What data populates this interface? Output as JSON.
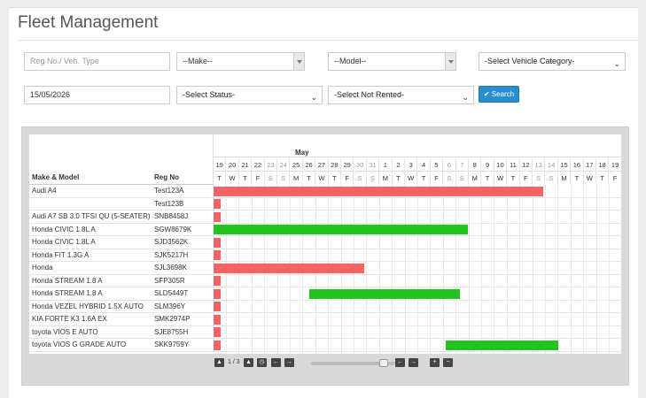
{
  "page": {
    "title": "Fleet Management"
  },
  "filters": {
    "reg_placeholder": "Reg No./ Veh. Type",
    "make": "--Make--",
    "model": "--Model--",
    "vehicle_category": "-Select Vehicle Category-",
    "date": "15/05/2026",
    "status": "-Select Status-",
    "not_rented": "-Select Not Rented-",
    "search_label": "Search"
  },
  "gantt": {
    "col_make_model": "Make & Model",
    "col_reg": "Reg No",
    "month": "May",
    "days": [
      "19",
      "20",
      "21",
      "22",
      "23",
      "24",
      "25",
      "26",
      "27",
      "28",
      "29",
      "30",
      "31",
      "1",
      "2",
      "3",
      "4",
      "5",
      "6",
      "7",
      "8",
      "9",
      "10",
      "11",
      "12",
      "13",
      "14",
      "15",
      "16",
      "17",
      "18",
      "19"
    ],
    "dows": [
      "T",
      "W",
      "T",
      "F",
      "S",
      "S",
      "M",
      "T",
      "W",
      "T",
      "F",
      "S",
      "S",
      "M",
      "T",
      "W",
      "T",
      "F",
      "S",
      "S",
      "M",
      "T",
      "W",
      "T",
      "F",
      "S",
      "S",
      "M",
      "T",
      "W",
      "T",
      "F"
    ],
    "weekend_index": [
      4,
      5,
      11,
      12,
      18,
      19,
      25,
      26
    ],
    "rows": [
      {
        "make_model": "Audi A4",
        "reg": "Test123A"
      },
      {
        "make_model": "",
        "reg": "Test123B"
      },
      {
        "make_model": "Audi A7 SB 3.0 TFSI QU (5-SEATER)",
        "reg": "SNB8458J"
      },
      {
        "make_model": "Honda CIVIC 1.8L A",
        "reg": "SGW8679K"
      },
      {
        "make_model": "Honda CIVIC 1.8L A",
        "reg": "SJD3562K"
      },
      {
        "make_model": "Honda FIT 1.3G A",
        "reg": "SJK5217H"
      },
      {
        "make_model": "Honda",
        "reg": "SJL3698K"
      },
      {
        "make_model": "Honda STREAM 1.8 A",
        "reg": "SFP305R"
      },
      {
        "make_model": "Honda STREAM 1.8 A",
        "reg": "SLD5449T"
      },
      {
        "make_model": "Honda VEZEL HYBRID 1.5X AUTO",
        "reg": "SLM396Y"
      },
      {
        "make_model": "KIA FORTE K3 1.6A EX",
        "reg": "SMK2974P"
      },
      {
        "make_model": "toyota VIOS E AUTO",
        "reg": "SJE8755H"
      },
      {
        "make_model": "toyota VIOS G GRADE AUTO",
        "reg": "SKK9759Y"
      }
    ],
    "bars": [
      {
        "row": 0,
        "start": 0,
        "span": 25.8,
        "color": "red"
      },
      {
        "row": 1,
        "start": 0,
        "span": 0.55,
        "color": "red"
      },
      {
        "row": 2,
        "start": 0,
        "span": 0.55,
        "color": "red"
      },
      {
        "row": 3,
        "start": 0,
        "span": 19.9,
        "color": "green"
      },
      {
        "row": 4,
        "start": 0,
        "span": 0.55,
        "color": "red"
      },
      {
        "row": 5,
        "start": 0,
        "span": 0.55,
        "color": "red"
      },
      {
        "row": 6,
        "start": 0,
        "span": 11.8,
        "color": "red"
      },
      {
        "row": 7,
        "start": 0,
        "span": 0.55,
        "color": "red"
      },
      {
        "row": 8,
        "start": 0,
        "span": 0.55,
        "color": "red"
      },
      {
        "row": 8,
        "start": 7.5,
        "span": 11.8,
        "color": "green"
      },
      {
        "row": 9,
        "start": 0,
        "span": 0.55,
        "color": "red"
      },
      {
        "row": 10,
        "start": 0,
        "span": 0.55,
        "color": "red"
      },
      {
        "row": 11,
        "start": 0,
        "span": 0.55,
        "color": "red"
      },
      {
        "row": 12,
        "start": 0,
        "span": 0.55,
        "color": "red"
      },
      {
        "row": 12,
        "start": 18.2,
        "span": 8.8,
        "color": "green"
      }
    ]
  },
  "pager": {
    "text": "1 / 3",
    "zoom_fraction": 0.9
  },
  "icons": {
    "up": "arrow-up-icon",
    "down": "arrow-down-icon",
    "clock": "clock-icon",
    "left": "arrow-left-icon",
    "right": "arrow-right-icon",
    "plus": "plus-icon",
    "minus": "minus-icon"
  },
  "colors": {
    "accent": "#2a8fd0",
    "booked": "#f76262",
    "available": "#22c21f"
  }
}
